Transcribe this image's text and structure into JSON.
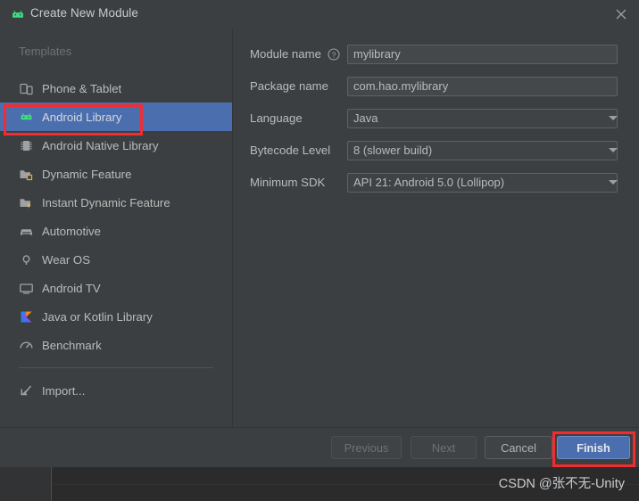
{
  "window": {
    "title": "Create New Module",
    "app_icon": "android-icon",
    "close_icon": "close-icon"
  },
  "sidebar": {
    "section_label": "Templates",
    "items": [
      {
        "label": "Phone & Tablet",
        "icon": "phone-tablet-icon",
        "selected": false
      },
      {
        "label": "Android Library",
        "icon": "android-icon",
        "selected": true
      },
      {
        "label": "Android Native Library",
        "icon": "native-library-icon",
        "selected": false
      },
      {
        "label": "Dynamic Feature",
        "icon": "dynamic-feature-icon",
        "selected": false
      },
      {
        "label": "Instant Dynamic Feature",
        "icon": "instant-dynamic-feature-icon",
        "selected": false
      },
      {
        "label": "Automotive",
        "icon": "automotive-icon",
        "selected": false
      },
      {
        "label": "Wear OS",
        "icon": "wear-os-icon",
        "selected": false
      },
      {
        "label": "Android TV",
        "icon": "android-tv-icon",
        "selected": false
      },
      {
        "label": "Java or Kotlin Library",
        "icon": "kotlin-icon",
        "selected": false
      },
      {
        "label": "Benchmark",
        "icon": "benchmark-icon",
        "selected": false
      }
    ],
    "import_item": {
      "label": "Import...",
      "icon": "import-icon"
    }
  },
  "form": {
    "fields": [
      {
        "label": "Module name",
        "value": "mylibrary",
        "type": "text",
        "help": true
      },
      {
        "label": "Package name",
        "value": "com.hao.mylibrary",
        "type": "text",
        "help": false
      },
      {
        "label": "Language",
        "value": "Java",
        "type": "combo",
        "help": false
      },
      {
        "label": "Bytecode Level",
        "value": "8 (slower build)",
        "type": "combo",
        "help": false
      },
      {
        "label": "Minimum SDK",
        "value": "API 21: Android 5.0 (Lollipop)",
        "type": "combo",
        "help": false
      }
    ],
    "help_icon": "question-mark-icon"
  },
  "buttons": {
    "previous": "Previous",
    "next": "Next",
    "cancel": "Cancel",
    "finish": "Finish"
  },
  "annotations": {
    "highlight_color": "#f42c30",
    "highlighted": [
      "Android Library",
      "Finish"
    ]
  },
  "watermark": {
    "text": "CSDN @张不无-Unity"
  },
  "colors": {
    "dialog_background": "#3c3f41",
    "selection_blue": "#4b6eaf",
    "android_green": "#3ddc84",
    "text": "#bbbbbb",
    "muted_text": "#6e7275"
  }
}
